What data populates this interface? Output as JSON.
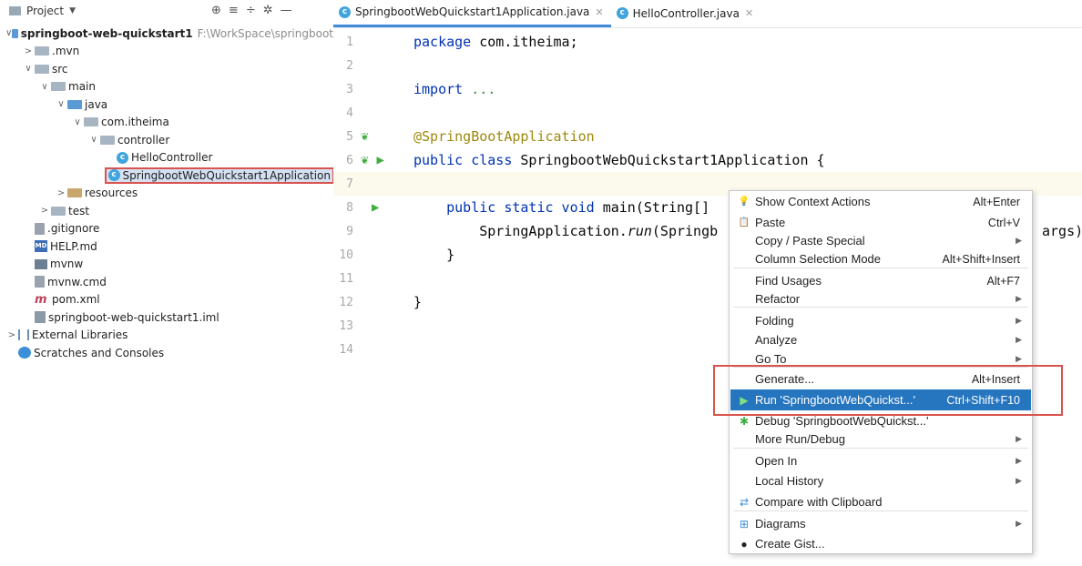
{
  "project_panel": {
    "title": "Project",
    "tree": [
      {
        "label": "springboot-web-quickstart1",
        "path": "F:\\WorkSpace\\springboot",
        "indent": 0,
        "arrow": "▽",
        "icon": "folder-blue",
        "bold": true
      },
      {
        "label": ".mvn",
        "indent": 1,
        "arrow": ">",
        "icon": "folder"
      },
      {
        "label": "src",
        "indent": 1,
        "arrow": "▽",
        "icon": "folder"
      },
      {
        "label": "main",
        "indent": 2,
        "arrow": "▽",
        "icon": "folder"
      },
      {
        "label": "java",
        "indent": 3,
        "arrow": "▽",
        "icon": "folder-blue"
      },
      {
        "label": "com.itheima",
        "indent": 4,
        "arrow": "▽",
        "icon": "pkg"
      },
      {
        "label": "controller",
        "indent": 5,
        "arrow": "▽",
        "icon": "pkg"
      },
      {
        "label": "HelloController",
        "indent": 6,
        "arrow": "",
        "icon": "cls"
      },
      {
        "label": "SpringbootWebQuickstart1Application",
        "indent": 6,
        "arrow": "",
        "icon": "cls",
        "selected": true
      },
      {
        "label": "resources",
        "indent": 3,
        "arrow": ">",
        "icon": "folder-res"
      },
      {
        "label": "test",
        "indent": 2,
        "arrow": ">",
        "icon": "folder"
      },
      {
        "label": ".gitignore",
        "indent": 1,
        "arrow": "",
        "icon": "file"
      },
      {
        "label": "HELP.md",
        "indent": 1,
        "arrow": "",
        "icon": "md"
      },
      {
        "label": "mvnw",
        "indent": 1,
        "arrow": "",
        "icon": "mvn"
      },
      {
        "label": "mvnw.cmd",
        "indent": 1,
        "arrow": "",
        "icon": "file"
      },
      {
        "label": "pom.xml",
        "indent": 1,
        "arrow": "",
        "icon": "pom"
      },
      {
        "label": "springboot-web-quickstart1.iml",
        "indent": 1,
        "arrow": "",
        "icon": "iml"
      },
      {
        "label": "External Libraries",
        "indent": 0,
        "arrow": ">",
        "icon": "lib"
      },
      {
        "label": "Scratches and Consoles",
        "indent": 0,
        "arrow": "",
        "icon": "scratch"
      }
    ]
  },
  "tabs": [
    {
      "label": "SpringbootWebQuickstart1Application.java",
      "active": true
    },
    {
      "label": "HelloController.java",
      "active": false
    }
  ],
  "editor": {
    "line_numbers": [
      "1",
      "2",
      "3",
      "4",
      "5",
      "6",
      "7",
      "8",
      "9",
      "10",
      "11",
      "12",
      "13",
      "14"
    ],
    "code": {
      "l1_kw": "package",
      "l1_rest": " com.itheima;",
      "l3_kw": "import",
      "l3_rest": " ...",
      "l6_ann": "@SpringBootApplication",
      "l7_kw": "public class",
      "l7_rest": " SpringbootWebQuickstart1Application {",
      "l9_kw": "public static void",
      "l9_rest": " main(String[]",
      "l10_a": "SpringApplication.",
      "l10_b": "run",
      "l10_c": "(Springb",
      "l10_tail": "args)",
      "l11": "}",
      "l13": "}"
    }
  },
  "context_menu": {
    "items": [
      {
        "label": "Show Context Actions",
        "shortcut": "Alt+Enter",
        "icon": "bulb-icon"
      },
      {
        "label": "Paste",
        "shortcut": "Ctrl+V",
        "icon": "clipboard-icon"
      },
      {
        "label": "Copy / Paste Special",
        "submenu": true
      },
      {
        "label": "Column Selection Mode",
        "shortcut": "Alt+Shift+Insert"
      },
      {
        "label": "Find Usages",
        "shortcut": "Alt+F7"
      },
      {
        "label": "Refactor",
        "submenu": true
      },
      {
        "label": "Folding",
        "submenu": true
      },
      {
        "label": "Analyze",
        "submenu": true
      },
      {
        "label": "Go To",
        "submenu": true
      },
      {
        "label": "Generate...",
        "shortcut": "Alt+Insert"
      },
      {
        "label": "Run 'SpringbootWebQuickst...'",
        "shortcut": "Ctrl+Shift+F10",
        "icon": "run-icon",
        "highlighted": true
      },
      {
        "label": "Debug 'SpringbootWebQuickst...'",
        "icon": "debug-icon"
      },
      {
        "label": "More Run/Debug",
        "submenu": true
      },
      {
        "label": "Open In",
        "submenu": true
      },
      {
        "label": "Local History",
        "submenu": true
      },
      {
        "label": "Compare with Clipboard",
        "icon": "compare-icon"
      },
      {
        "label": "Diagrams",
        "submenu": true,
        "icon": "diagram-icon"
      },
      {
        "label": "Create Gist...",
        "icon": "github-icon"
      }
    ]
  },
  "colors": {
    "accent": "#2675bf",
    "annotation_red": "#d9534f",
    "keyword": "#0033b3",
    "annotation": "#9e880d"
  }
}
